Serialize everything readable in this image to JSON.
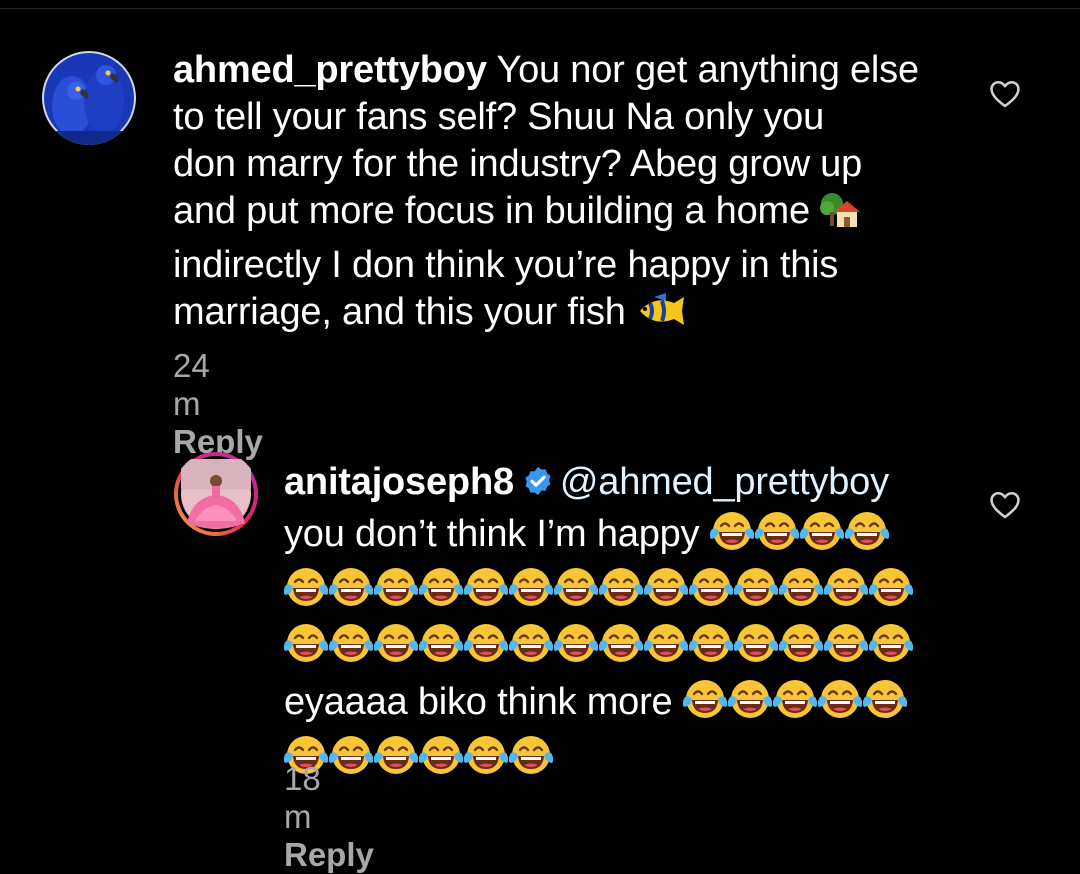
{
  "comments": [
    {
      "username": "ahmed_prettyboy",
      "lines": [
        " You nor get anything else",
        "to tell your fans self?  Shuu Na only you",
        "don marry for the industry? Abeg grow up",
        "and put more focus in building a home ",
        "indirectly I don think you’re happy in this",
        "marriage, and this your fish "
      ],
      "emojis": [
        "house-with-garden-icon",
        "tropical-fish-icon"
      ],
      "time": "24 m",
      "reply_label": "Reply",
      "avatar": "blue-macaws-avatar"
    },
    {
      "username": "anitajoseph8",
      "verified": true,
      "mention": "@ahmed_prettyboy",
      "lines": [
        "you don’t think I’m happy ",
        "",
        "",
        "eyaaaa biko think more ",
        ""
      ],
      "emoji_counts": [
        4,
        14,
        14,
        5,
        6
      ],
      "emoji_name": "face-with-tears-of-joy-icon",
      "time": "18 m",
      "reply_label": "Reply",
      "avatar": "pink-gown-avatar"
    }
  ],
  "colors": {
    "background": "#000000",
    "text": "#ffffff",
    "meta": "#a8a8a8",
    "verified": "#3897f0"
  }
}
